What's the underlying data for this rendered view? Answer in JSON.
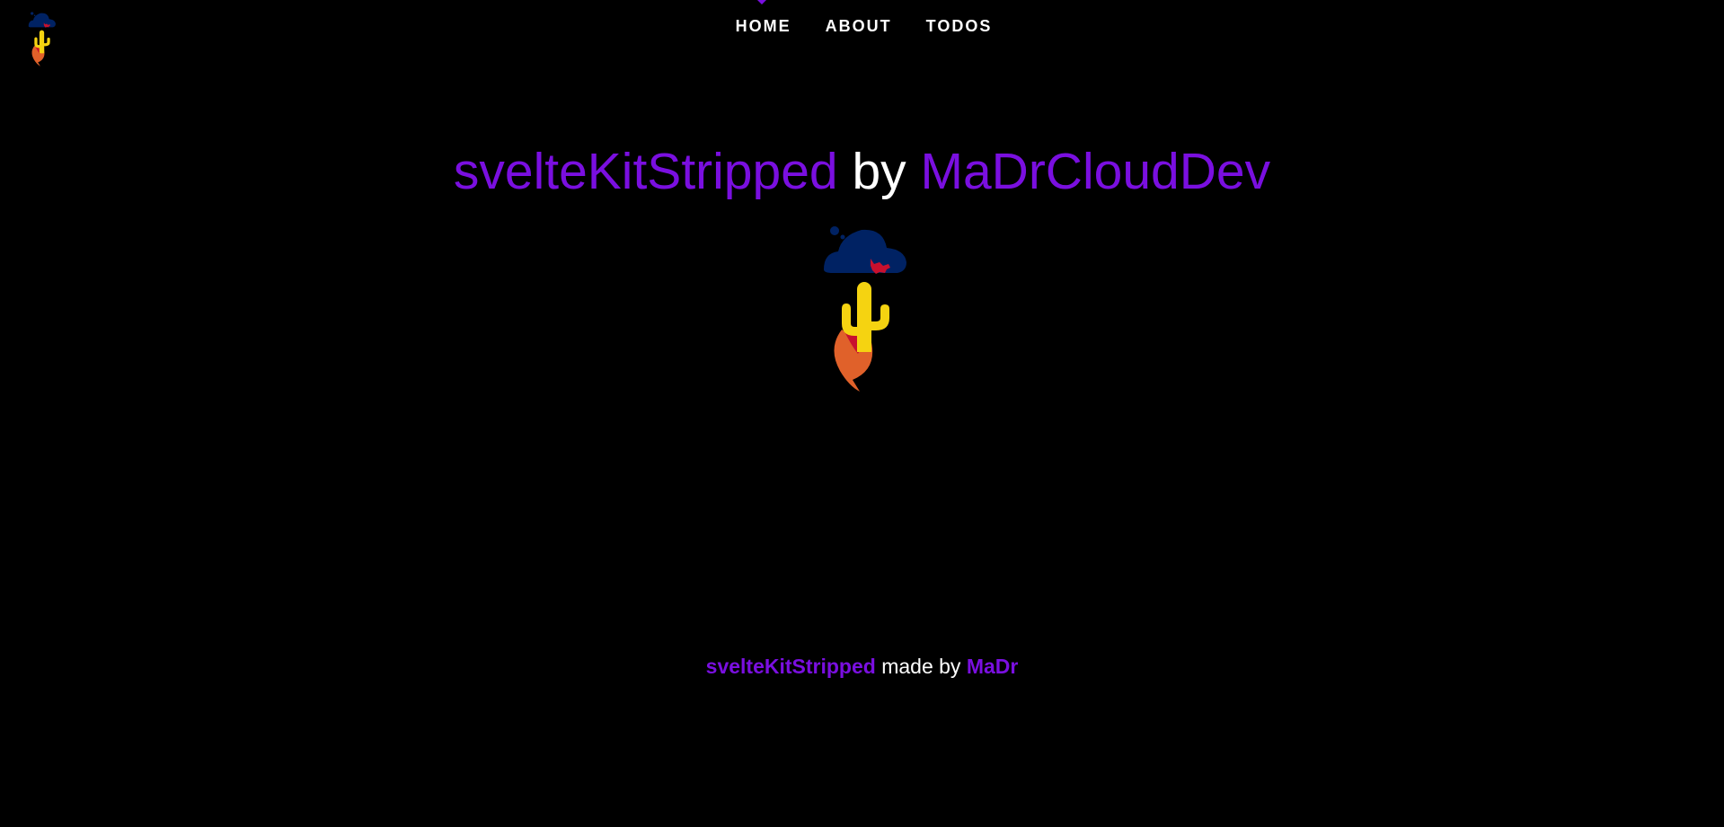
{
  "logo": {
    "icon": "cloud-cactus-flame-logo",
    "colors": {
      "cloud": "#002263",
      "cactus": "#f5d311",
      "flame_outer": "#e0612a",
      "flame_inner": "#c8102e",
      "animal": "#c8102e"
    }
  },
  "nav": {
    "items": [
      {
        "label": "HOME",
        "active": true
      },
      {
        "label": "ABOUT",
        "active": false
      },
      {
        "label": "TODOS",
        "active": false
      }
    ],
    "active_indicator_color": "#7a0fe0"
  },
  "hero": {
    "title_part1": "svelteKitStripped",
    "title_part2": " by ",
    "title_part3": "MaDrCloudDev"
  },
  "footer": {
    "part1": "svelteKitStripped",
    "part2": " made by ",
    "part3": "MaDr"
  },
  "colors": {
    "background": "#000000",
    "accent": "#7a0fe0",
    "text": "#ffffff"
  }
}
